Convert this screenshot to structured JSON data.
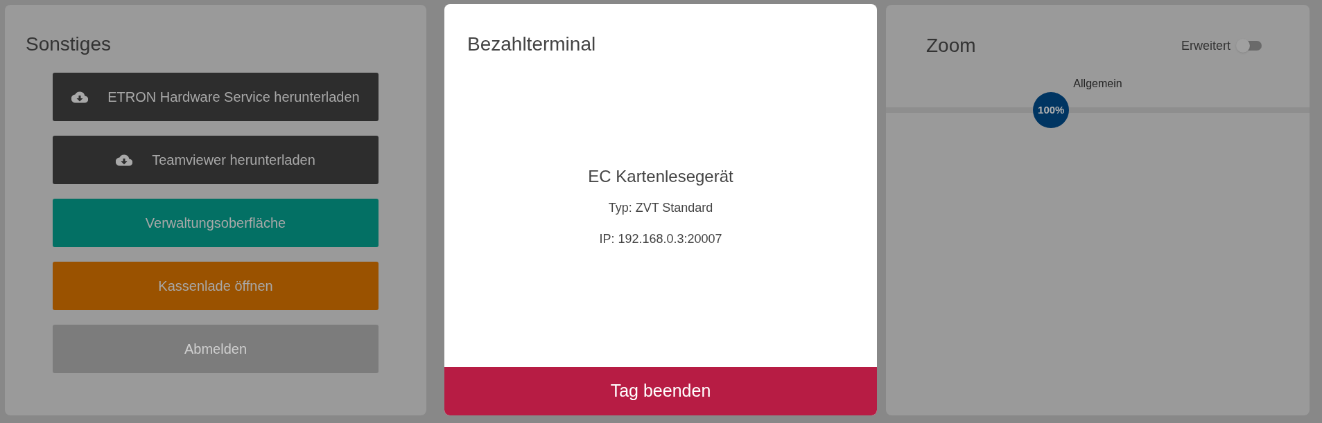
{
  "sonstiges": {
    "title": "Sonstiges",
    "buttons": [
      {
        "label": "ETRON Hardware Service herunterladen",
        "kind": "download",
        "disabled": false
      },
      {
        "label": "Teamviewer herunterladen",
        "kind": "download",
        "disabled": false
      },
      {
        "label": "Verwaltungsoberfläche",
        "kind": "admin",
        "disabled": false
      },
      {
        "label": "Kassenlade öffnen",
        "kind": "drawer",
        "disabled": false
      },
      {
        "label": "Abmelden",
        "kind": "logout",
        "disabled": true
      }
    ]
  },
  "terminal": {
    "title": "Bezahlterminal",
    "device": "EC Kartenlesegerät",
    "type": "Typ: ZVT Standard",
    "ip": "IP: 192.168.0.3:20007",
    "action": "Tag beenden"
  },
  "zoom": {
    "title": "Zoom",
    "toggle": {
      "label": "Erweitert",
      "on": false
    },
    "slider": {
      "label": "Allgemein",
      "value": "100%",
      "level": 0.39
    }
  }
}
